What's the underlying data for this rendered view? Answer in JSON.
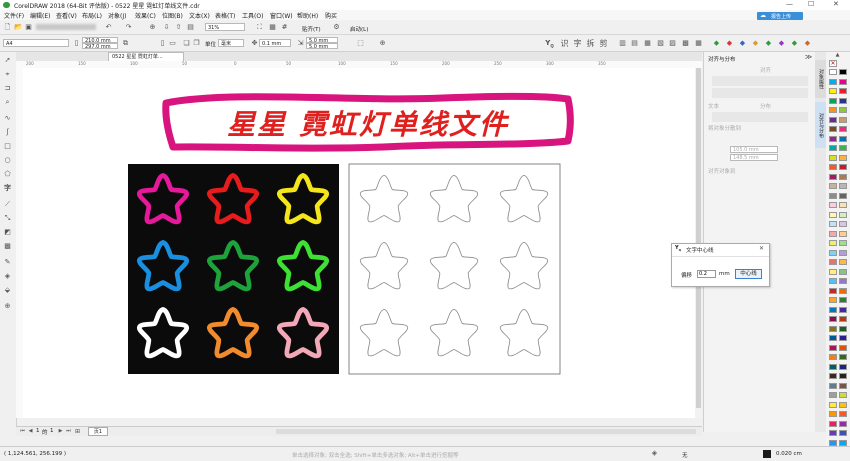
{
  "app": {
    "title": "CorelDRAW 2018 (64-Bit 评估版) - 0522 星星 霓虹灯单线文件.cdr",
    "upload_label": "报告上传"
  },
  "menus": [
    "文件(F)",
    "编辑(E)",
    "查看(V)",
    "布局(L)",
    "对象(J)",
    "效果(C)",
    "位图(B)",
    "文本(X)",
    "表格(T)",
    "工具(O)",
    "窗口(W)",
    "帮助(H)",
    "购买"
  ],
  "toolbar": {
    "zoom": "31%",
    "snap_label": "贴齐(T)",
    "launch_label": "启动(L)"
  },
  "property_bar": {
    "page_size": "A4",
    "width": "210.0 mm",
    "height": "297.0 mm",
    "units_label": "单位",
    "units": "毫米",
    "nudge": "0.1 mm",
    "dup_x": "5.0 mm",
    "dup_y": "5.0 mm",
    "plugin_chars": [
      "识",
      "字",
      "拆",
      "剪"
    ]
  },
  "document_tab": "0522 星星 霓虹灯单...",
  "ruler": {
    "h_ticks": [
      "200",
      "150",
      "100",
      "50",
      "0",
      "50",
      "100",
      "150",
      "200",
      "250",
      "300",
      "350"
    ]
  },
  "canvas": {
    "banner_text": "星星 霓虹灯单线文件",
    "left_panel": {
      "background": "#0b0b0b",
      "stars": [
        {
          "color": "#e5199a"
        },
        {
          "color": "#e81c1c"
        },
        {
          "color": "#f4e61a"
        },
        {
          "color": "#1a8fe0"
        },
        {
          "color": "#1ea23c"
        },
        {
          "color": "#3ee034"
        },
        {
          "color": "#ffffff"
        },
        {
          "color": "#f28a2e"
        },
        {
          "color": "#f2a8b6"
        }
      ]
    },
    "right_panel": {
      "outline_color": "#8a8a8a",
      "star_count": 9
    }
  },
  "dialog": {
    "title": "文字中心线",
    "offset_label": "偏移",
    "offset_value": "0.2",
    "unit": "mm",
    "button_label": "中心线"
  },
  "docker": {
    "title": "对齐与分布",
    "align_label": "对齐",
    "distribute_label": "分布",
    "text_label": "文本",
    "spacing_label": "将对象分散到",
    "x_value": "105.0 mm",
    "y_value": "148.5 mm",
    "object_spacing_label": "对齐对象到",
    "side_tabs": [
      "对象属性",
      "对齐与分布"
    ]
  },
  "page_nav": {
    "current": "1",
    "of_label": "的",
    "total": "1",
    "page_tab": "页1"
  },
  "status": {
    "coordinates": "( 1,124.561, 256.199 )",
    "hint": "单击选择对象; 双击全选; Shift+单击多选对象; Alt+单击进行挖掘等",
    "fill_label": "无",
    "outline_width": "0.020 cm"
  },
  "palette": {
    "colors": [
      "#ffffff",
      "#000000",
      "#00aeef",
      "#e9008c",
      "#fff200",
      "#ed1c24",
      "#00a651",
      "#2e3192",
      "#f7941d",
      "#8dc63f",
      "#662d91",
      "#c69c6d",
      "#754c24",
      "#ee2a7b",
      "#92278f",
      "#0072bc",
      "#00a99d",
      "#39b54a",
      "#d7df23",
      "#fbb040",
      "#f15a29",
      "#be1e2d",
      "#9e1f63",
      "#a67c52",
      "#c2b59b",
      "#b7b7b7",
      "#8c8c8c",
      "#636363",
      "#ffccdd",
      "#fde0b2",
      "#fff7b0",
      "#d1f0c0",
      "#bfe4f5",
      "#d8c4e8",
      "#f6a6b2",
      "#ffcf8a",
      "#e8f26d",
      "#9be08a",
      "#7fd3f2",
      "#b39ddb",
      "#e57373",
      "#ffb74d",
      "#fff176",
      "#81c784",
      "#4fc3f7",
      "#9575cd",
      "#c62828",
      "#ef6c00",
      "#f9a825",
      "#2e7d32",
      "#0277bd",
      "#4527a0",
      "#880e4f",
      "#bf360c",
      "#827717",
      "#1b5e20",
      "#01579b",
      "#311b92",
      "#ad1457",
      "#e65100",
      "#f57f17",
      "#33691e",
      "#006064",
      "#1a237e",
      "#3e2723",
      "#212121",
      "#607d8b",
      "#795548",
      "#9e9e9e",
      "#cddc39",
      "#ffeb3b",
      "#ffc107",
      "#ff9800",
      "#ff5722",
      "#e91e63",
      "#9c27b0",
      "#673ab7",
      "#3f51b5",
      "#2196f3",
      "#03a9f4"
    ]
  }
}
